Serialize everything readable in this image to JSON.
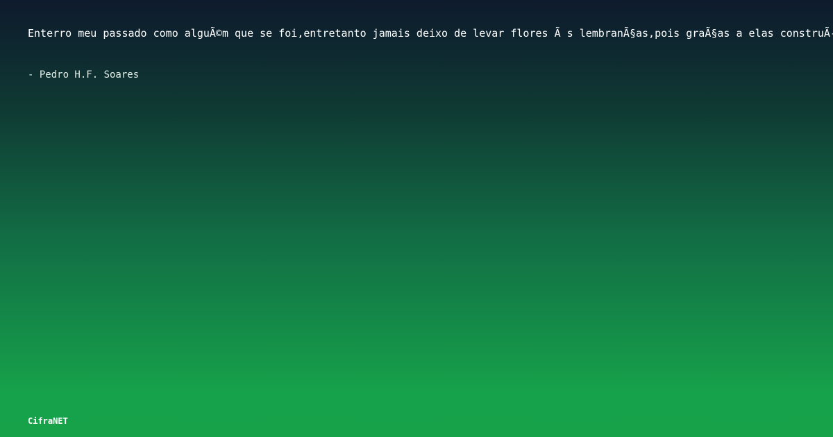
{
  "quote": {
    "text": "Enterro meu passado como alguÃ©m que se foi,entretanto jamais deixo de levar flores Ã s lembranÃ§as,pois graÃ§as a elas construÃ-",
    "author": "- Pedro H.F. Soares"
  },
  "brand": {
    "name": "CifraNET"
  },
  "colors": {
    "background_top": "#0e1a2d",
    "background_bottom": "#17a24a",
    "text": "#ffffff"
  }
}
